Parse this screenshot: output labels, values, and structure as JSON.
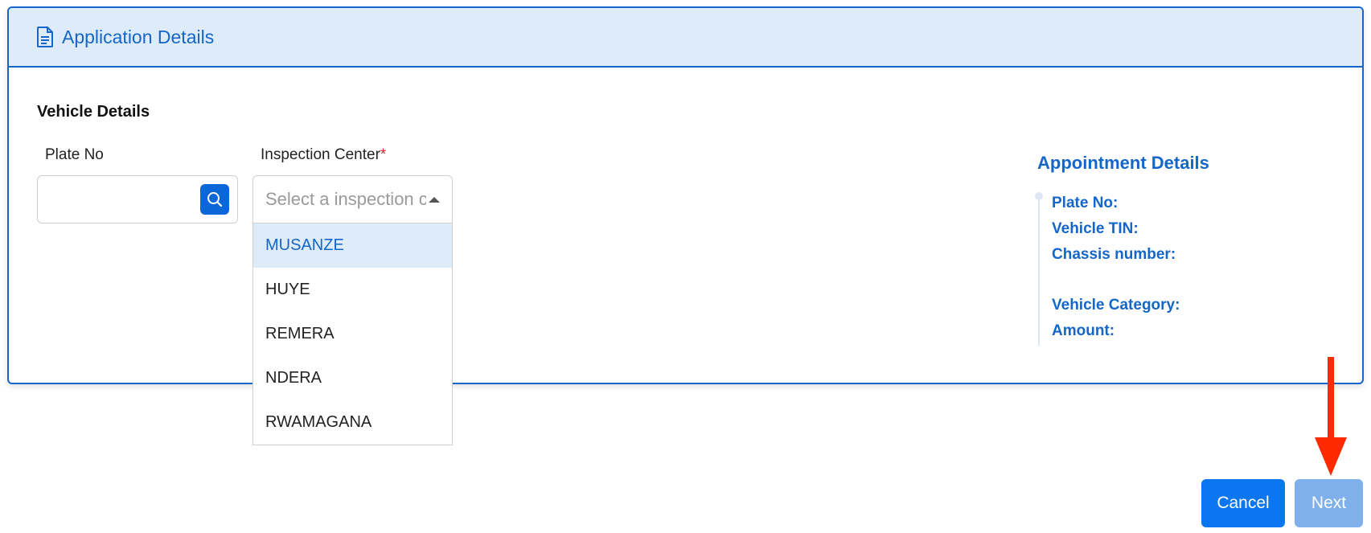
{
  "header": {
    "title": "Application Details",
    "icon": "document-icon"
  },
  "vehicle": {
    "section_title": "Vehicle Details",
    "plate_label": "Plate No",
    "plate_value": "",
    "inspection_label": "Inspection Center",
    "required_mark": "*",
    "inspection_placeholder": "Select a inspection center",
    "options": [
      "MUSANZE",
      "HUYE",
      "REMERA",
      "NDERA",
      "RWAMAGANA"
    ],
    "highlighted_option": "MUSANZE"
  },
  "appointment": {
    "title": "Appointment Details",
    "plate_no": "Plate No:",
    "vehicle_tin": "Vehicle TIN:",
    "chassis": "Chassis number:",
    "category": "Vehicle Category:",
    "amount": "Amount:"
  },
  "actions": {
    "cancel": "Cancel",
    "next": "Next"
  },
  "colors": {
    "accent": "#1466c8",
    "header_bg": "#deebf8",
    "cancel_bg": "#0b76f0",
    "next_bg": "#7fb0ec",
    "annotation_arrow": "#ff2a00"
  }
}
